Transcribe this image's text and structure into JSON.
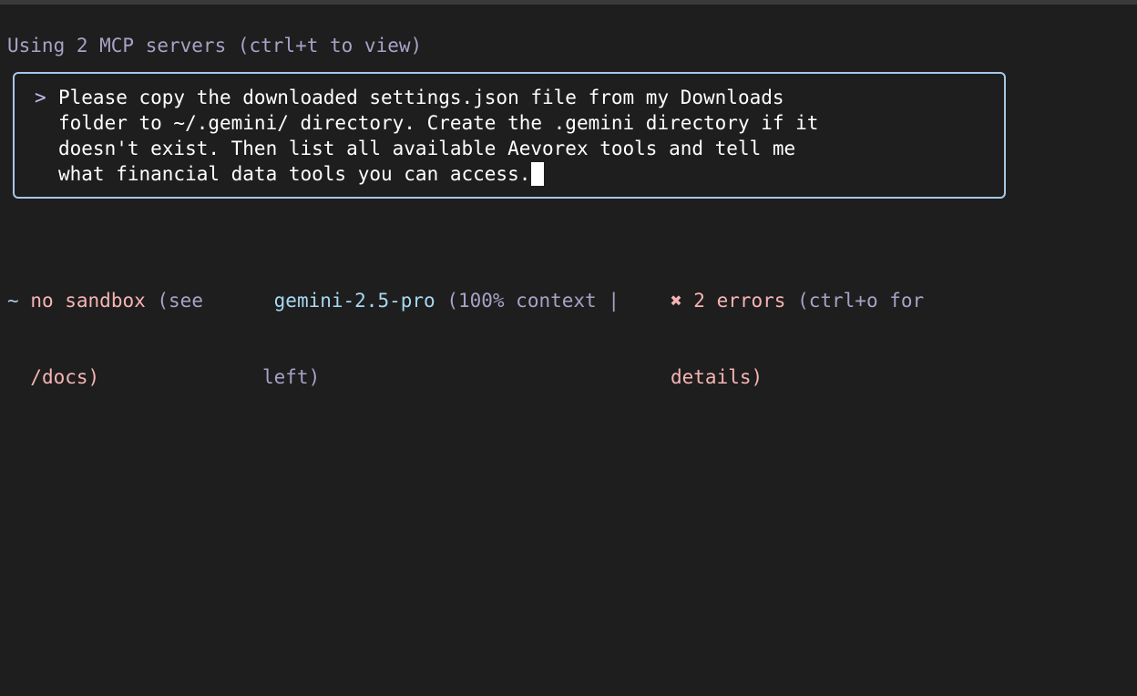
{
  "terminal": {
    "mcp_line": "Using 2 MCP servers (ctrl+t to view)",
    "prompt": {
      "marker": ">",
      "lines": [
        "Please copy the downloaded settings.json file from my Downloads",
        "folder to ~/.gemini/ directory. Create the .gemini directory if it",
        "doesn't exist. Then list all available Aevorex tools and tell me",
        "what financial data tools you can access."
      ]
    },
    "status": {
      "cwd_symbol": "~",
      "sandbox_label": "no sandbox",
      "sandbox_hint_1": " (see",
      "sandbox_hint_2": "/docs)",
      "model_name": "gemini-2.5-pro",
      "model_context_1": " (100% context |",
      "model_context_2": "left)",
      "errors_icon": "✖",
      "errors_label": " 2 errors",
      "errors_hint_1": " (ctrl+o for",
      "errors_hint_2": "details)"
    }
  },
  "colors": {
    "background": "#1e1e1e",
    "box_border": "#a7c7e7",
    "muted_text": "#a7a2c6",
    "error_text": "#f7b4b4",
    "model_text": "#a7d8f0"
  }
}
